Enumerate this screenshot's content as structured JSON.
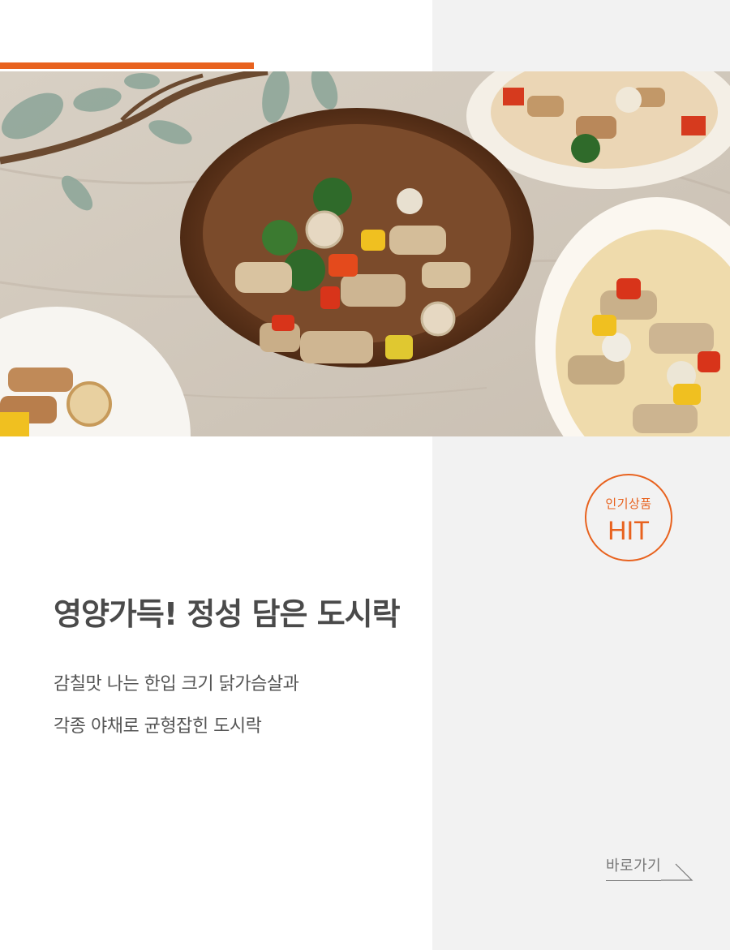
{
  "hero": {
    "image_alt": "도시락 음식 사진"
  },
  "badge": {
    "top_text": "인기상품",
    "main_text": "HIT"
  },
  "headline": "영양가득! 정성 담은 도시락",
  "description": {
    "line1": "감칠맛 나는 한입 크기 닭가슴살과",
    "line2": "각종 야채로 균형잡힌 도시락"
  },
  "link": {
    "label": "바로가기"
  },
  "colors": {
    "accent": "#e8621e",
    "text_dark": "#4a4a4a",
    "panel_bg": "#f2f2f2"
  }
}
